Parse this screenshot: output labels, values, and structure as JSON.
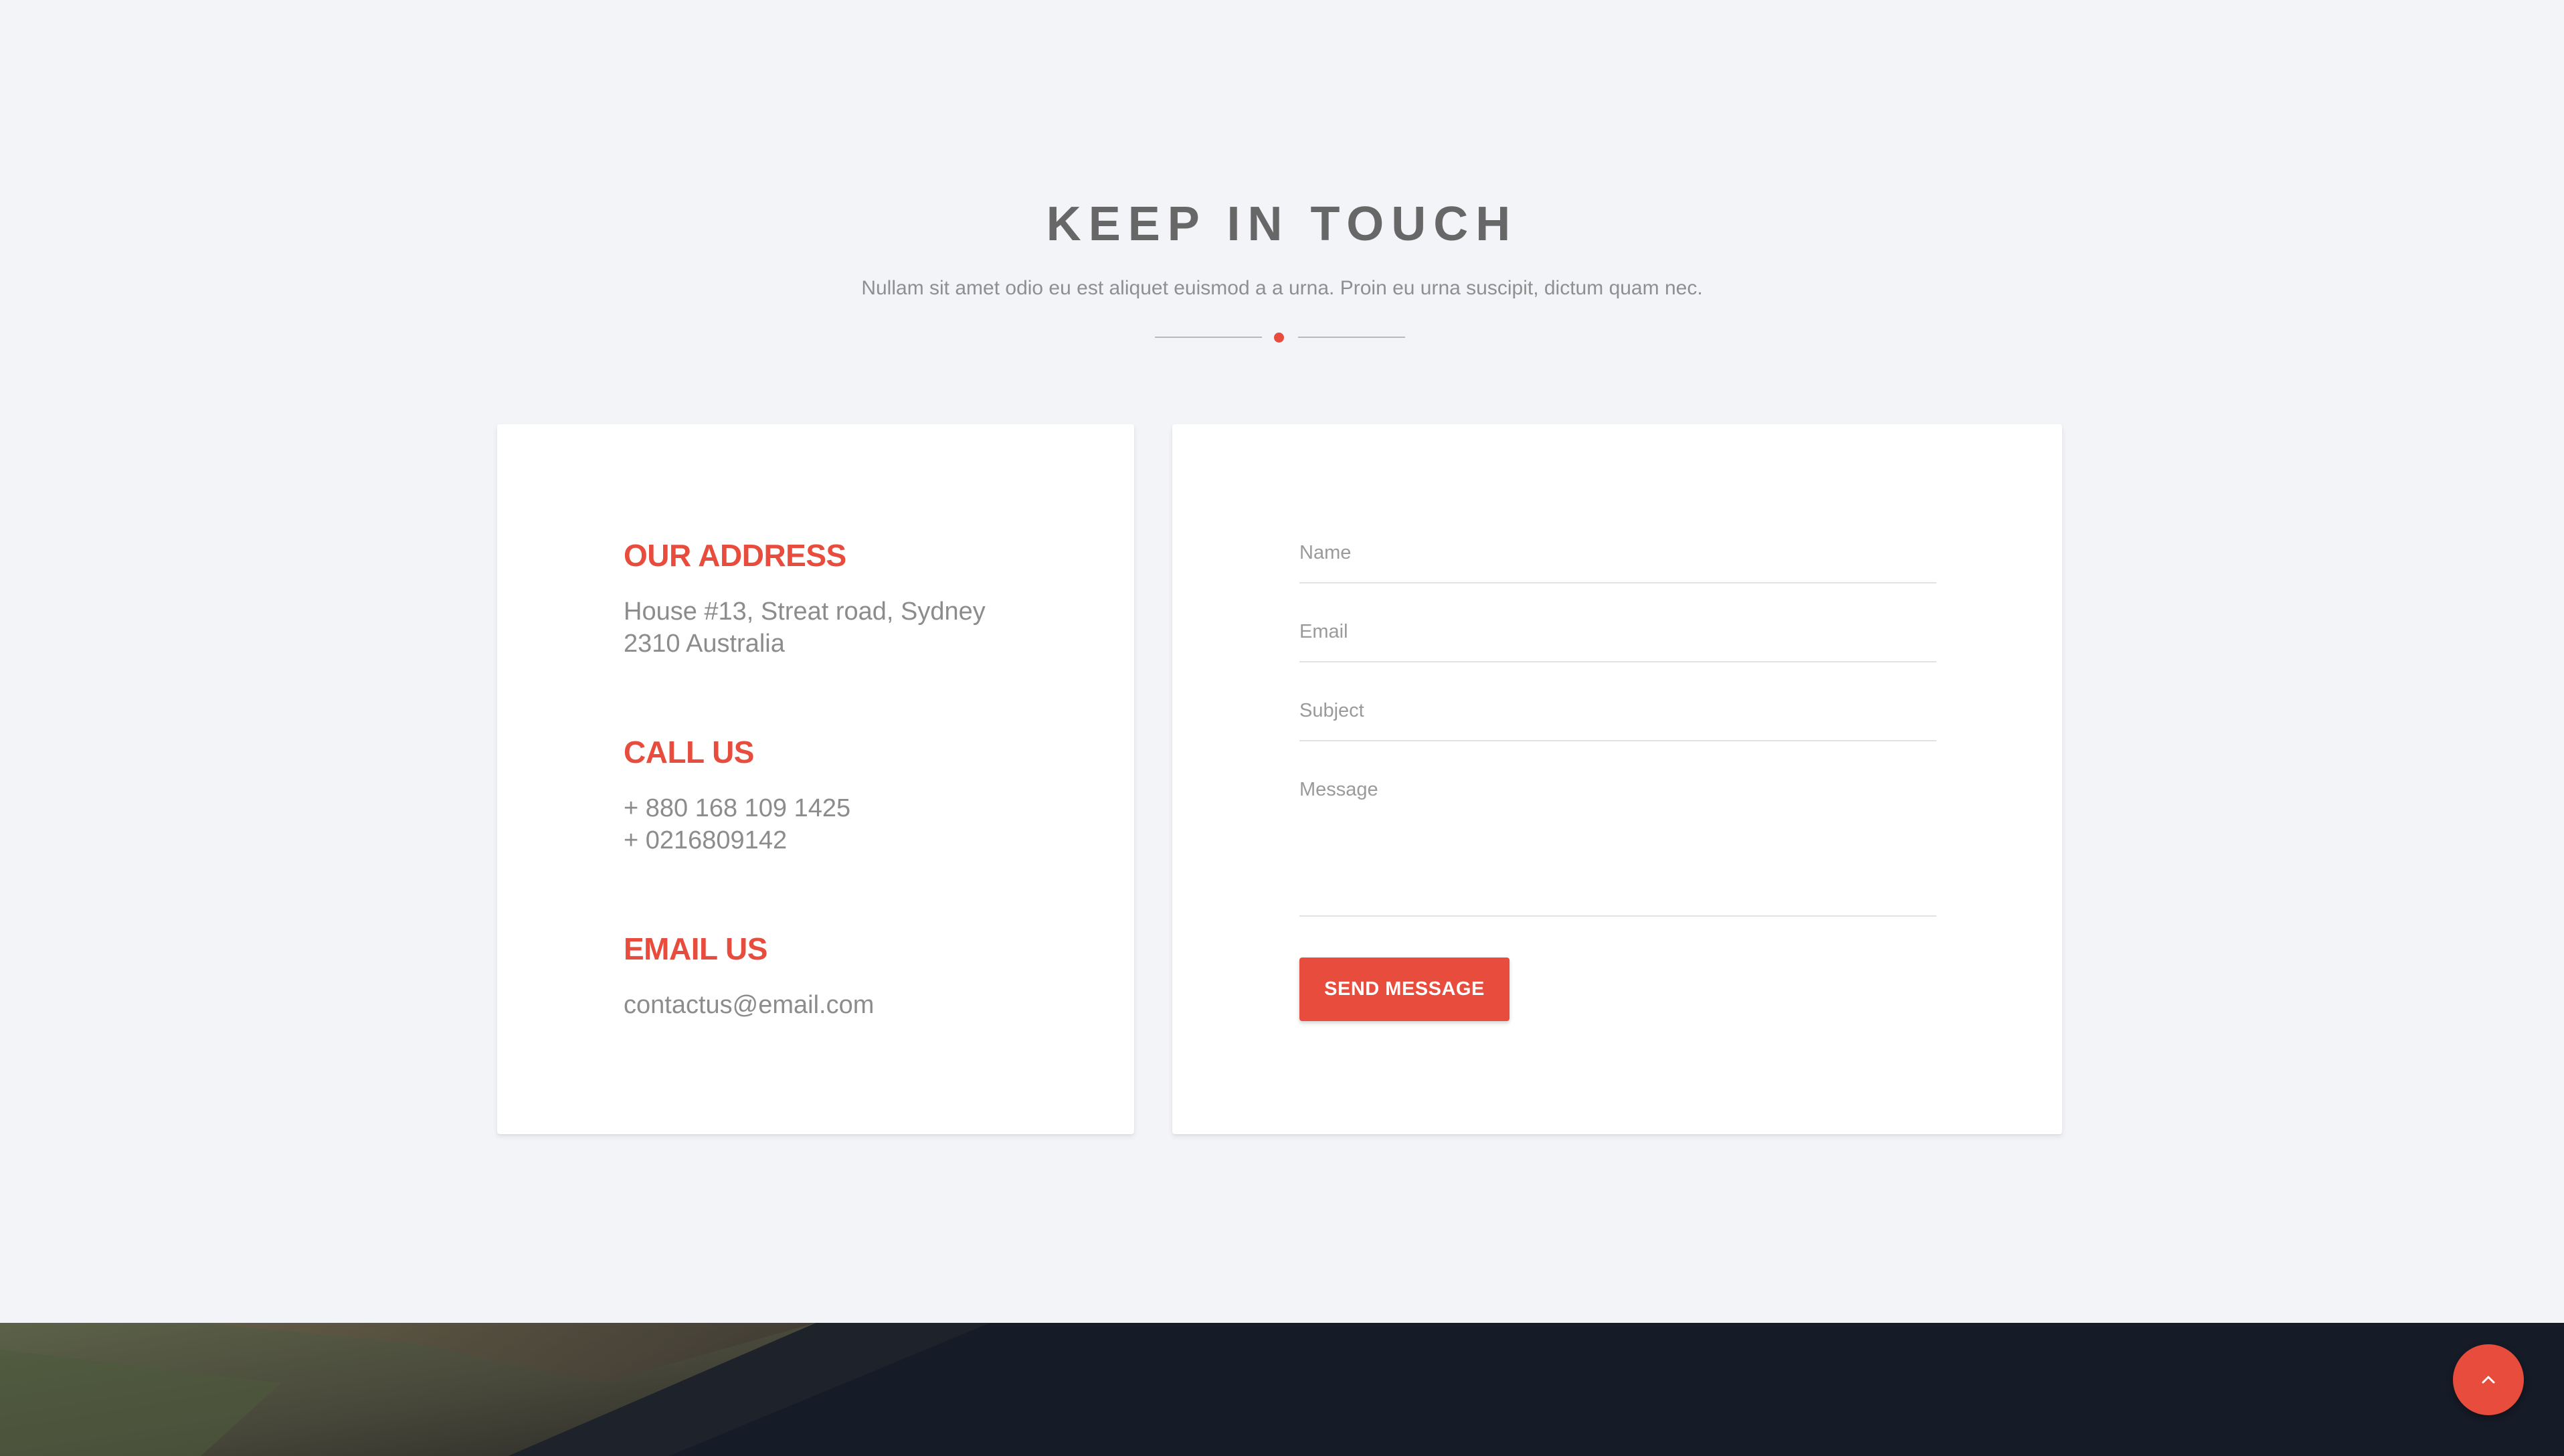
{
  "section": {
    "title": "KEEP IN TOUCH",
    "subtitle": "Nullam sit amet odio eu est aliquet euismod a a urna. Proin eu urna suscipit, dictum quam nec."
  },
  "contact_info": {
    "address": {
      "heading": "OUR ADDRESS",
      "lines": [
        "House #13, Streat road, Sydney",
        "2310 Australia"
      ]
    },
    "call": {
      "heading": "CALL US",
      "lines": [
        "+ 880 168 109 1425",
        "+ 0216809142"
      ]
    },
    "email": {
      "heading": "EMAIL US",
      "lines": [
        "contactus@email.com"
      ]
    }
  },
  "form": {
    "name_placeholder": "Name",
    "email_placeholder": "Email",
    "subject_placeholder": "Subject",
    "message_placeholder": "Message",
    "submit_label": "SEND MESSAGE"
  },
  "scroll_top": {
    "icon": "chevron-up-icon"
  },
  "colors": {
    "accent": "#e74c3c",
    "background": "#f3f4f8",
    "card": "#ffffff",
    "heading_gray": "#676767",
    "text_gray": "#8c8c8c"
  }
}
